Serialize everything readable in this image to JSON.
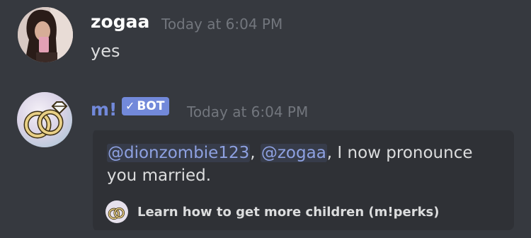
{
  "messages": [
    {
      "username": "zogaa",
      "timestamp": "Today at 6:04 PM",
      "text": "yes",
      "avatar_icon": "user-photo-avatar"
    },
    {
      "username": "m!",
      "username_color": "#7289da",
      "bot_label": "BOT",
      "bot_check": "✓",
      "timestamp": "Today at 6:04 PM",
      "avatar_icon": "wedding-rings-avatar",
      "embed": {
        "mention1": "@dionzombie123",
        "sep1": ", ",
        "mention2": "@zogaa",
        "rest_line1": ", I now pronounce",
        "line2": "you married.",
        "footer_text": "Learn how to get more children (m!perks)",
        "footer_icon": "wedding-rings-icon"
      }
    }
  ],
  "colors": {
    "background": "#36393f",
    "embed_background": "#2f3136",
    "mention": "#8ea1e1",
    "timestamp": "#72767d",
    "badge": "#7289da"
  }
}
